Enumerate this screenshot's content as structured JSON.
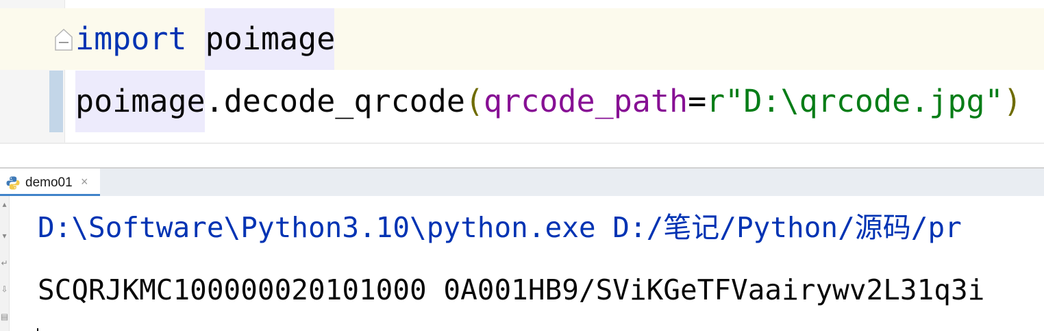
{
  "editor": {
    "line1": {
      "keyword": "import",
      "space": " ",
      "module": "poimage"
    },
    "line2": {
      "object": "poimage",
      "method": ".decode_qrcode",
      "open_paren": "(",
      "param": "qrcode_path",
      "equals": "=",
      "string": "r\"D:\\qrcode.jpg\"",
      "close_paren": ")"
    }
  },
  "run_panel": {
    "tab_label": "demo01",
    "tab_close": "×",
    "tab_icon": "python-icon"
  },
  "console": {
    "command_line": "D:\\Software\\Python3.10\\python.exe D:/笔记/Python/源码/pr",
    "output_line": "SCQRJKMC100000020101000 0A001HB9/SViKGeTFVaairywv2L31q3i"
  },
  "colors": {
    "keyword": "#0033b3",
    "parameter": "#871094",
    "string": "#067d17",
    "paren": "#6f6c00",
    "tab_accent": "#4083c9"
  }
}
